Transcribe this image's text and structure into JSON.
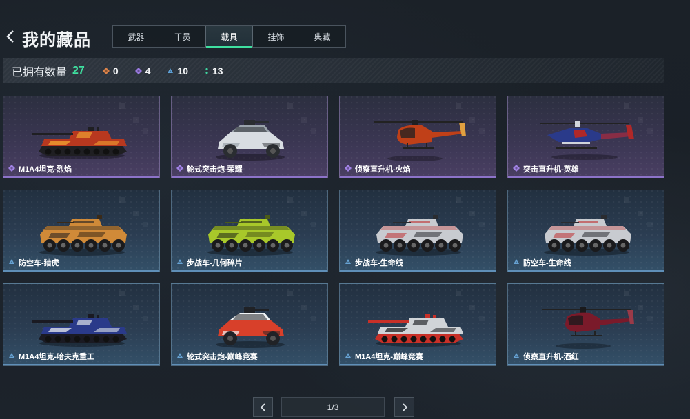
{
  "header": {
    "back_icon": "chevron-left-icon",
    "title": "我的藏品"
  },
  "tabs": [
    {
      "label": "武器",
      "active": false
    },
    {
      "label": "干员",
      "active": false
    },
    {
      "label": "载具",
      "active": true
    },
    {
      "label": "挂饰",
      "active": false
    },
    {
      "label": "典藏",
      "active": false
    }
  ],
  "stats": {
    "owned_label": "已拥有数量",
    "owned_count": "27",
    "counts": [
      {
        "icon": "orange-diamond-icon",
        "color": "#d9824a",
        "value": "0"
      },
      {
        "icon": "purple-diamond-icon",
        "color": "#9a7ae0",
        "value": "4"
      },
      {
        "icon": "blue-triangle-icon",
        "color": "#5fa2d8",
        "value": "10"
      },
      {
        "icon": "green-dots-icon",
        "color": "#3fd6a0",
        "value": "13"
      }
    ]
  },
  "cards": [
    {
      "name": "M1A4坦克-烈焰",
      "rarity": "purple",
      "vehicle": "tank",
      "palette": [
        "#b8381f",
        "#1f1f22",
        "#f0a030"
      ]
    },
    {
      "name": "轮式突击炮-荣耀",
      "rarity": "purple",
      "vehicle": "buggy",
      "palette": [
        "#d8dde2",
        "#2a2d31",
        "#9aa3ab"
      ]
    },
    {
      "name": "侦察直升机-火焰",
      "rarity": "purple",
      "vehicle": "scout-heli",
      "palette": [
        "#c04018",
        "#202022",
        "#e0a040"
      ]
    },
    {
      "name": "突击直升机-英雄",
      "rarity": "purple",
      "vehicle": "attack-heli",
      "palette": [
        "#2a3a8a",
        "#b02828",
        "#d0d4da"
      ]
    },
    {
      "name": "防空车-猎虎",
      "rarity": "blue",
      "vehicle": "ifv",
      "palette": [
        "#d08a38",
        "#1e1e20",
        "#3a2a18"
      ]
    },
    {
      "name": "步战车-几何碎片",
      "rarity": "blue",
      "vehicle": "ifv",
      "palette": [
        "#a8c82a",
        "#1e2218",
        "#4a5a18"
      ]
    },
    {
      "name": "步战车-生命线",
      "rarity": "blue",
      "vehicle": "ifv",
      "palette": [
        "#c8cbd0",
        "#c03030",
        "#2a2c30"
      ]
    },
    {
      "name": "防空车-生命线",
      "rarity": "blue",
      "vehicle": "ifv",
      "palette": [
        "#c8cbd0",
        "#c03030",
        "#2a2c30"
      ]
    },
    {
      "name": "M1A4坦克-哈夫克重工",
      "rarity": "blue",
      "vehicle": "tank",
      "palette": [
        "#2a3a8a",
        "#1a1a22",
        "#e0e4ea"
      ]
    },
    {
      "name": "轮式突击炮-巅峰竞赛",
      "rarity": "blue",
      "vehicle": "buggy",
      "palette": [
        "#d8402a",
        "#202226",
        "#f2f4f6"
      ]
    },
    {
      "name": "M1A4坦克-巅峰竞赛",
      "rarity": "blue",
      "vehicle": "tank",
      "palette": [
        "#d0d4d8",
        "#c83028",
        "#2a2c30"
      ]
    },
    {
      "name": "侦察直升机-酒红",
      "rarity": "blue",
      "vehicle": "scout-heli",
      "palette": [
        "#7a1a2a",
        "#1a1a1c",
        "#9a3a48"
      ]
    }
  ],
  "pager": {
    "prev_icon": "chevron-left-icon",
    "next_icon": "chevron-right-icon",
    "page_text": "1/3"
  }
}
